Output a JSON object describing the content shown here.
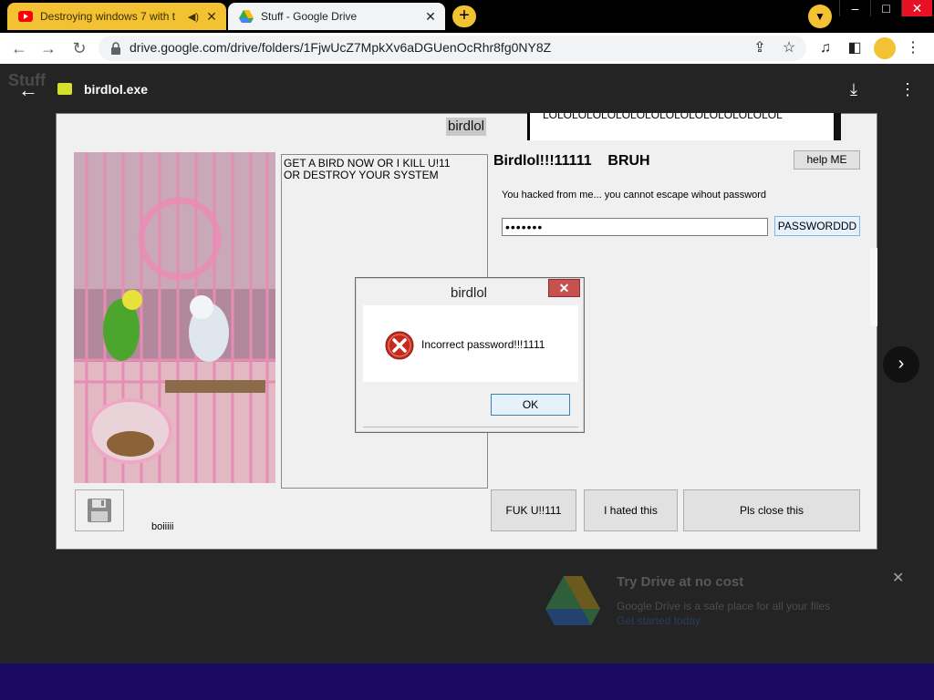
{
  "browser": {
    "tabs": [
      {
        "title": "Destroying windows 7 with t",
        "favicon": "youtube-icon",
        "active": false
      },
      {
        "title": "Stuff - Google Drive",
        "favicon": "google-drive-icon",
        "active": true
      }
    ],
    "new_tab_label": "+",
    "url": "drive.google.com/drive/folders/1FjwUcZ7MpkXv6aDGUenOcRhr8fg0NY8Z",
    "window_close": "✕"
  },
  "drive": {
    "folder_title": "Stuff",
    "file_name": "birdlol.exe",
    "promo": {
      "title": "Try Drive at no cost",
      "text": "Google Drive is a safe place for all your files",
      "link": "Get started today"
    }
  },
  "app": {
    "window_title": "birdlol",
    "lol_text": "LOLOLOLOLOLOLOLOLOLOLOLOLOLOLOLOL",
    "message_lines": [
      "GET A BIRD NOW OR I KILL U!11",
      "OR DESTROY YOUR SYSTEM"
    ],
    "heading": "Birdlol!!!11111    BRUH",
    "help_button": "help ME",
    "hacked_text": "You hacked from me... you cannot escape wihout password",
    "password_value": "•••••••",
    "password_button": "PASSWORDDD",
    "bottom_label": "boiiiii",
    "buttons": {
      "fuk": "FUK U!!111",
      "hated": "I hated this",
      "close": "Pls close this"
    }
  },
  "dialog": {
    "title": "birdlol",
    "message": "Incorrect password!!!1111",
    "ok_label": "OK",
    "close_label": "✕"
  },
  "colors": {
    "tab_accent": "#f2c232",
    "error_red": "#c42b1c",
    "dialog_close": "#c75050"
  }
}
